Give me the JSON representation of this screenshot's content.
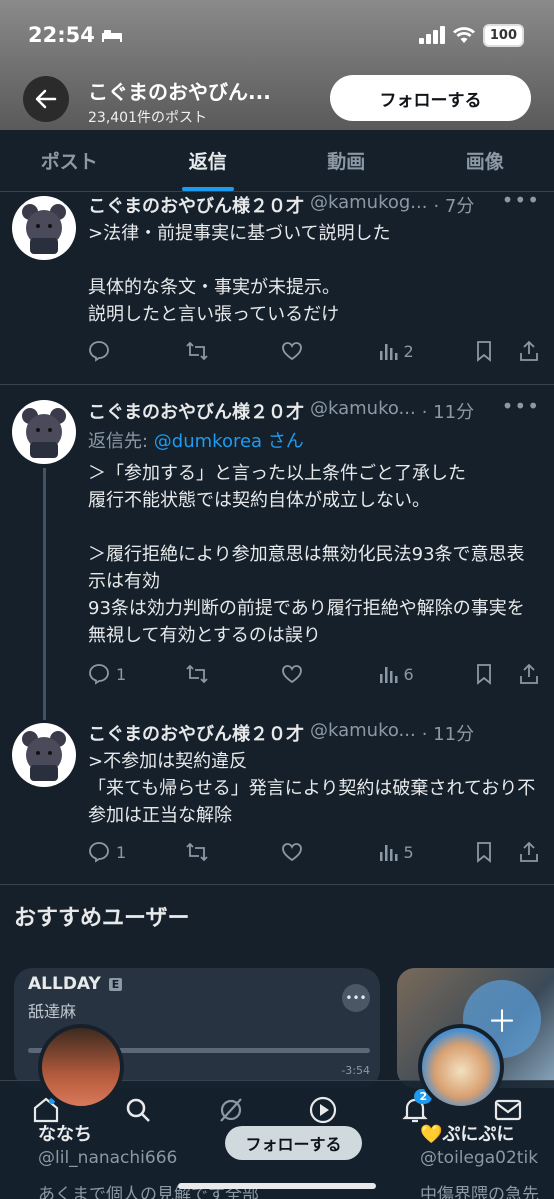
{
  "status": {
    "time": "22:54",
    "battery": "100"
  },
  "header": {
    "title": "こぐまのおやびん...",
    "post_count": "23,401件のポスト",
    "follow_label": "フォローする"
  },
  "tabs": [
    {
      "label": "ポスト",
      "active": false
    },
    {
      "label": "返信",
      "active": true
    },
    {
      "label": "動画",
      "active": false
    },
    {
      "label": "画像",
      "active": false
    }
  ],
  "tweets": [
    {
      "name": "こぐまのおやびん様２０才",
      "handle": "@kamukog...",
      "time": "· 7分",
      "body": ">法律・前提事実に基づいて説明した\n\n具体的な条文・事実が未提示。\n説明したと言い張っているだけ",
      "replies": "",
      "views": "2"
    },
    {
      "name": "こぐまのおやびん様２０才",
      "handle": "@kamuko...",
      "time": "· 11分",
      "reply_prefix": "返信先: ",
      "reply_user": "@dumkorea",
      "reply_suffix": " さん",
      "body": "＞「参加する」と言った以上条件ごと了承した\n履行不能状態では契約自体が成立しない。\n\n＞履行拒絶により参加意思は無効化民法93条で意思表示は有効\n93条は効力判断の前提であり履行拒絶や解除の事実を無視して有効とするのは誤り",
      "replies": "1",
      "views": "6"
    },
    {
      "name": "こぐまのおやびん様２０才",
      "handle": "@kamuko...",
      "time": "· 11分",
      "body": ">不参加は契約違反\n「来ても帰らせる」発言により契約は破棄されており不参加は正当な解除",
      "replies": "1",
      "views": "5"
    }
  ],
  "recommend": {
    "title": "おすすめユーザー",
    "card1": {
      "song_title": "ALLDAY",
      "badge": "E",
      "artist": "舐達麻",
      "time_left": "-3:54"
    },
    "users": [
      {
        "name": "ななち",
        "handle": "@lil_nanachi666",
        "bio": "あくまで個人の見解です全部"
      },
      {
        "name": "ぷにぷに",
        "handle": "@toilega02tik",
        "bio": "中傷界隈の急先"
      }
    ],
    "follow_label": "フォローする"
  },
  "bottom_nav": {
    "notification_count": "2"
  },
  "colors": {
    "accent": "#1d9bf0",
    "background": "#15202b",
    "muted": "#8b98a5"
  }
}
